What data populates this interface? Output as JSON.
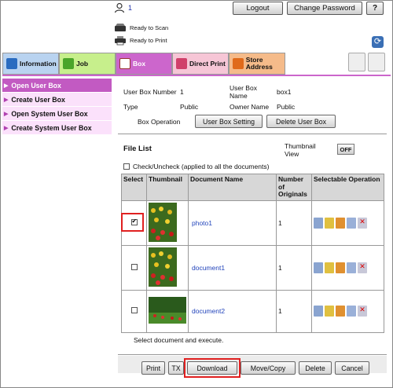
{
  "header": {
    "user_count": "1",
    "logout_label": "Logout",
    "change_password_label": "Change Password",
    "help_label": "?",
    "status_scan": "Ready to Scan",
    "status_print": "Ready to Print"
  },
  "tabs": [
    {
      "label": "Information",
      "color": "#b9d3f0"
    },
    {
      "label": "Job",
      "color": "#c7ef8c"
    },
    {
      "label": "Box",
      "color": "#cc66cc"
    },
    {
      "label": "Direct Print",
      "color": "#f6c6d6"
    },
    {
      "label": "Store Address",
      "color": "#f5bb8a"
    }
  ],
  "sidebar": {
    "items": [
      {
        "label": "Open User Box"
      },
      {
        "label": "Create User Box"
      },
      {
        "label": "Open System User Box"
      },
      {
        "label": "Create System User Box"
      }
    ]
  },
  "box_info": {
    "number_label": "User Box Number",
    "number_value": "1",
    "name_label": "User Box Name",
    "name_value": "box1",
    "type_label": "Type",
    "type_value": "Public",
    "owner_label": "Owner Name",
    "owner_value": "Public",
    "operation_label": "Box Operation",
    "setting_button": "User Box Setting",
    "delete_button": "Delete User Box"
  },
  "file_list": {
    "title": "File List",
    "thumbnail_view_label": "Thumbnail View",
    "thumbnail_view_value": "OFF",
    "check_all_label": "Check/Uncheck (applied to all the documents)",
    "columns": [
      "Select",
      "Thumbnail",
      "Document Name",
      "Number of Originals",
      "Selectable Operation"
    ],
    "rows": [
      {
        "name": "photo1",
        "originals": "1",
        "selected": true
      },
      {
        "name": "document1",
        "originals": "1",
        "selected": false
      },
      {
        "name": "document2",
        "originals": "1",
        "selected": false
      }
    ],
    "instruction": "Select document and execute."
  },
  "actions": {
    "print": "Print",
    "tx": "TX",
    "download": "Download",
    "move_copy": "Move/Copy",
    "delete": "Delete",
    "cancel": "Cancel"
  },
  "colors": {
    "accent_box": "#cc66cc",
    "sidebar_bg": "#fbe1fb",
    "link_blue": "#2244bb",
    "highlight_red": "#e02020"
  },
  "icons": [
    "user-icon",
    "scanner-icon",
    "printer-icon",
    "refresh-icon",
    "info-icon",
    "job-icon",
    "box-icon",
    "print-icon",
    "address-icon",
    "doc-icon",
    "edit-icon",
    "send-icon",
    "copy-icon",
    "delete-icon"
  ]
}
